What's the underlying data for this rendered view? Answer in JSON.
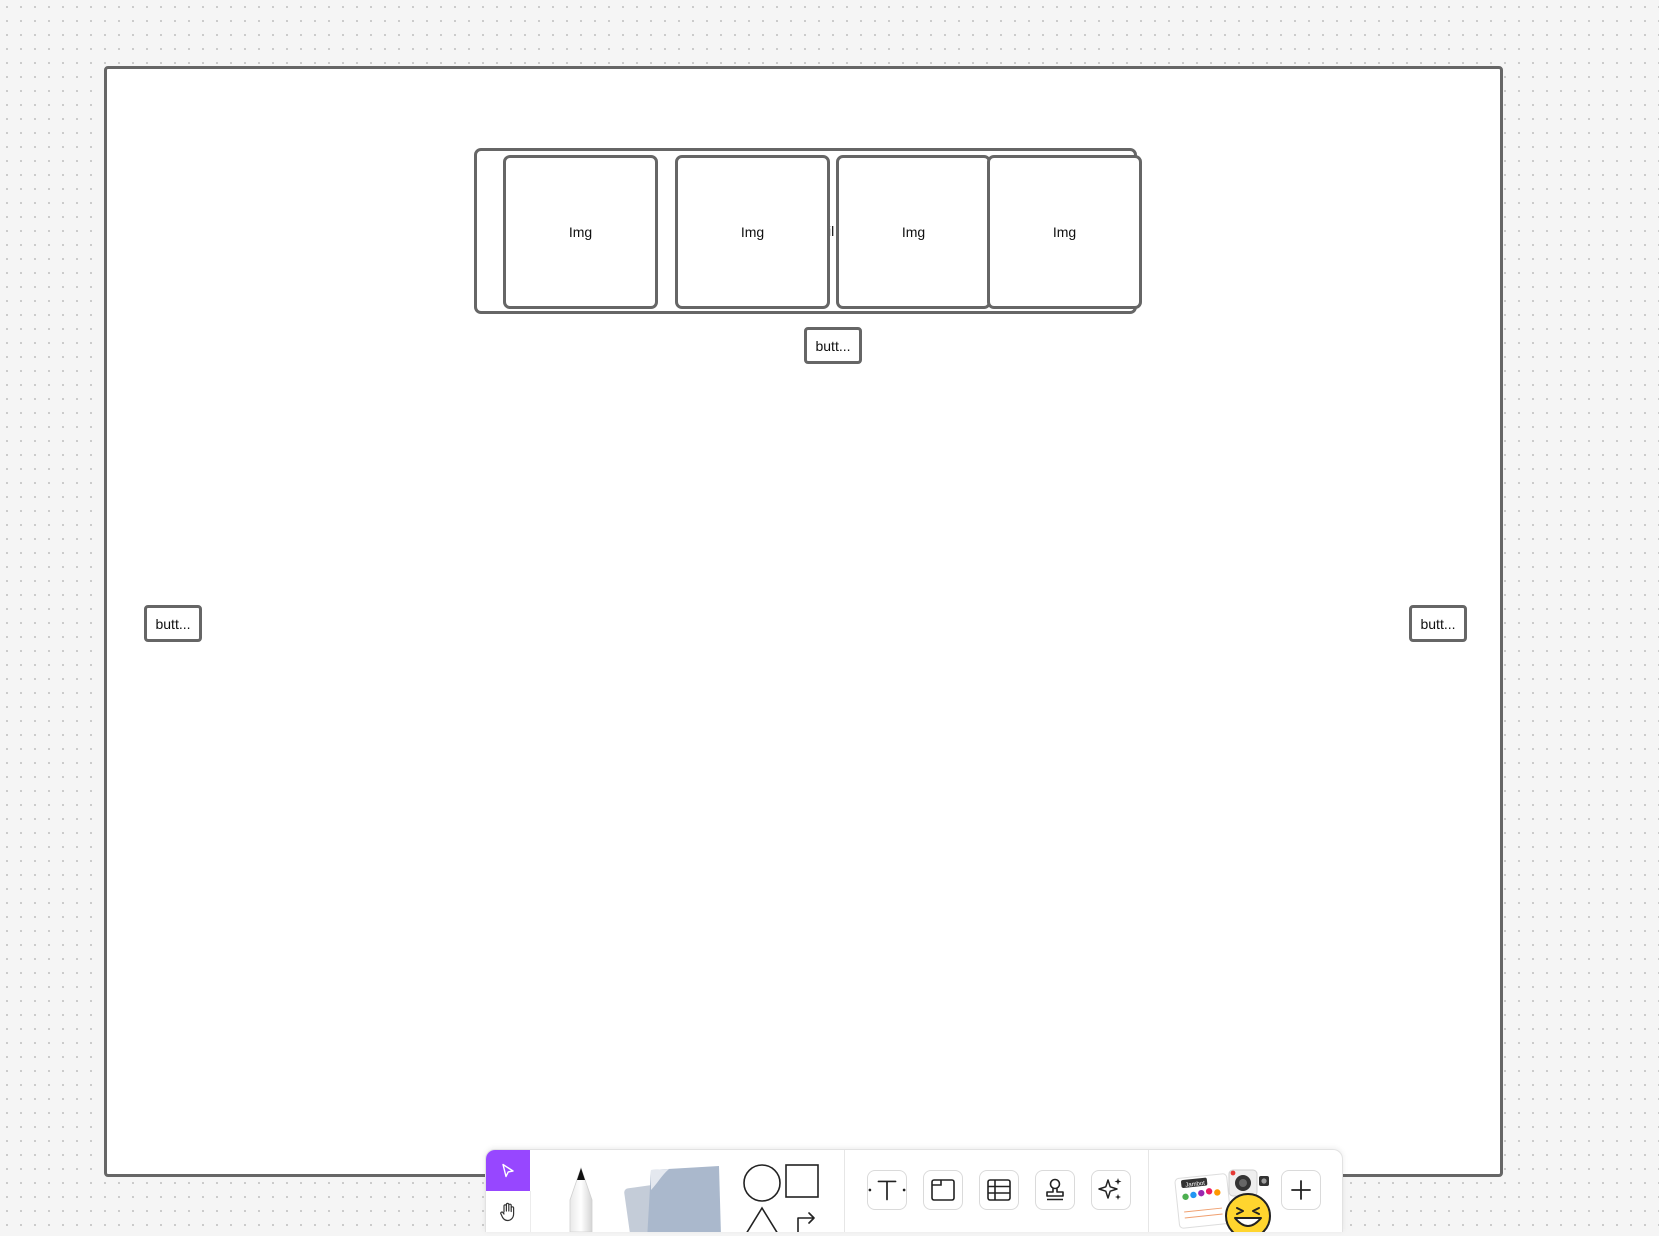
{
  "canvas": {
    "carousel": {
      "images": [
        "Img",
        "Img",
        "Img",
        "Img"
      ],
      "hidden_label": "il"
    },
    "buttons": {
      "center": "butt...",
      "left": "butt...",
      "right": "butt..."
    }
  },
  "toolbar": {
    "tools": [
      {
        "id": "select",
        "icon": "cursor-arrow-icon"
      },
      {
        "id": "hand",
        "icon": "hand-icon"
      },
      {
        "id": "pen",
        "icon": "pen-icon"
      },
      {
        "id": "sticky",
        "icon": "sticky-note-icon"
      },
      {
        "id": "shapes",
        "icon": "shapes-icon"
      },
      {
        "id": "text",
        "icon": "text-icon"
      },
      {
        "id": "section",
        "icon": "section-icon"
      },
      {
        "id": "table",
        "icon": "table-icon"
      },
      {
        "id": "stamp",
        "icon": "stamp-icon"
      },
      {
        "id": "ai",
        "icon": "sparkle-icon"
      },
      {
        "id": "widgets",
        "icon": "widgets-icon",
        "sticker_text": "Jambot"
      },
      {
        "id": "more",
        "icon": "plus-icon"
      }
    ],
    "colors": {
      "active": "#9747ff",
      "sticky": "#aab8cc",
      "emoji": "#ffd52e"
    }
  }
}
